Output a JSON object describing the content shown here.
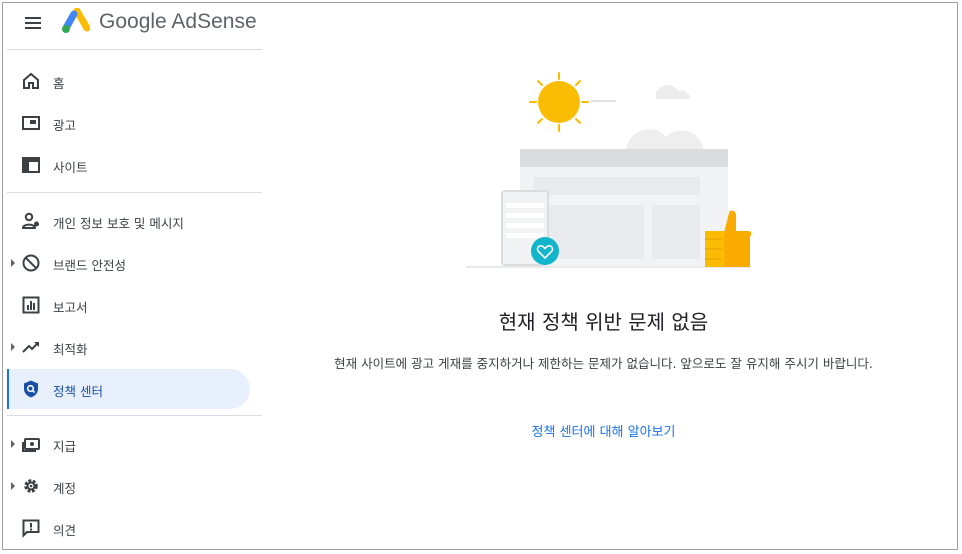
{
  "header": {
    "brand_google": "Google",
    "brand_product": "AdSense"
  },
  "sidebar": {
    "items": [
      {
        "label": "홈",
        "icon": "home-icon",
        "expandable": false
      },
      {
        "label": "광고",
        "icon": "ads-icon",
        "expandable": false
      },
      {
        "label": "사이트",
        "icon": "sites-icon",
        "expandable": false
      },
      {
        "label": "개인 정보 보호 및 메시지",
        "icon": "privacy-messaging-icon",
        "expandable": false
      },
      {
        "label": "브랜드 안전성",
        "icon": "block-icon",
        "expandable": true
      },
      {
        "label": "보고서",
        "icon": "reports-icon",
        "expandable": false
      },
      {
        "label": "최적화",
        "icon": "trending-up-icon",
        "expandable": true
      },
      {
        "label": "정책 센터",
        "icon": "policy-shield-icon",
        "expandable": false,
        "active": true
      },
      {
        "label": "지급",
        "icon": "payments-icon",
        "expandable": true
      },
      {
        "label": "계정",
        "icon": "gear-icon",
        "expandable": true
      },
      {
        "label": "의견",
        "icon": "feedback-icon",
        "expandable": false
      }
    ]
  },
  "main": {
    "headline": "현재 정책 위반 문제 없음",
    "description": "현재 사이트에 광고 게재를 중지하거나 제한하는 문제가 없습니다. 앞으로도 잘 유지해 주시기 바랍니다.",
    "link": "정책 센터에 대해 알아보기"
  },
  "colors": {
    "accent": "#1a73e8",
    "active_bg": "#e8f0fe",
    "sun": "#fbbc04",
    "heart_badge": "#12b5cb"
  }
}
